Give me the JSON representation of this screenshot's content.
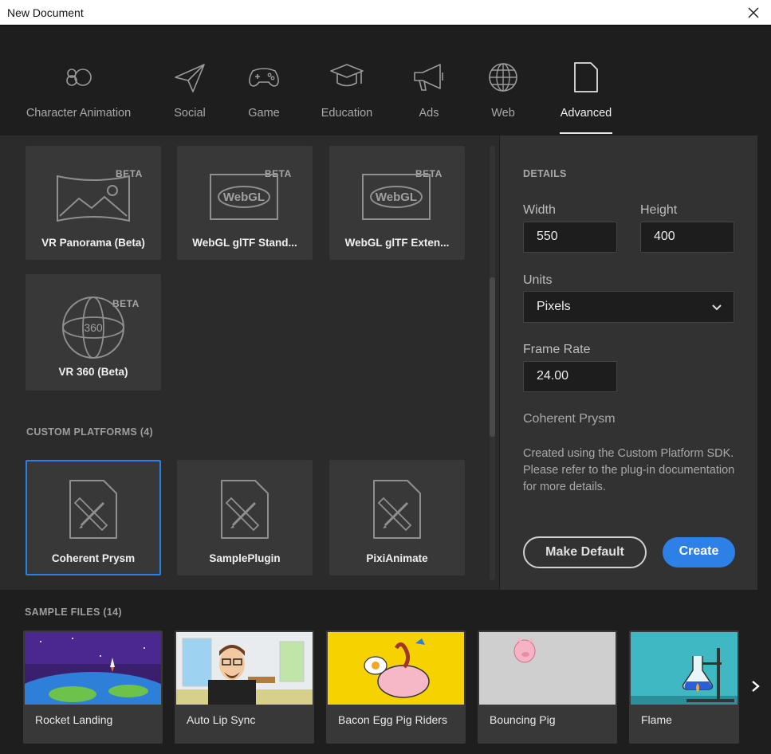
{
  "window": {
    "title": "New Document"
  },
  "tabs": [
    {
      "label": "Character Animation",
      "icon": "character-animation-icon"
    },
    {
      "label": "Social",
      "icon": "paper-plane-icon"
    },
    {
      "label": "Game",
      "icon": "gamepad-icon"
    },
    {
      "label": "Education",
      "icon": "graduation-cap-icon"
    },
    {
      "label": "Ads",
      "icon": "megaphone-icon"
    },
    {
      "label": "Web",
      "icon": "globe-icon"
    },
    {
      "label": "Advanced",
      "icon": "document-icon",
      "active": true
    }
  ],
  "presets": {
    "top_cards": [
      {
        "label": "VR Panorama (Beta)",
        "badge": "BETA",
        "icon": "vr-panorama-icon"
      },
      {
        "label": "WebGL glTF Stand...",
        "badge": "BETA",
        "icon": "webgl-icon"
      },
      {
        "label": "WebGL glTF Exten...",
        "badge": "BETA",
        "icon": "webgl-icon"
      },
      {
        "label": "VR 360 (Beta)",
        "badge": "BETA",
        "icon": "vr-360-icon"
      }
    ],
    "vr360_text": "360",
    "webgl_text": "WebGL",
    "custom_platforms_heading": "CUSTOM PLATFORMS (4)",
    "custom_platforms": [
      {
        "label": "Coherent Prysm",
        "selected": true,
        "icon": "plugin-document-icon"
      },
      {
        "label": "SamplePlugin",
        "icon": "plugin-document-icon"
      },
      {
        "label": "PixiAnimate",
        "icon": "plugin-document-icon"
      }
    ]
  },
  "details": {
    "heading": "DETAILS",
    "width_label": "Width",
    "width_value": "550",
    "height_label": "Height",
    "height_value": "400",
    "units_label": "Units",
    "units_value": "Pixels",
    "frame_rate_label": "Frame Rate",
    "frame_rate_value": "24.00",
    "preset_name": "Coherent Prysm",
    "preset_description": "Created using the Custom Platform SDK. Please refer to the plug-in documentation for more details.",
    "make_default_label": "Make Default",
    "create_label": "Create"
  },
  "samples": {
    "heading": "SAMPLE FILES (14)",
    "items": [
      {
        "label": "Rocket Landing"
      },
      {
        "label": "Auto Lip Sync"
      },
      {
        "label": "Bacon Egg Pig Riders"
      },
      {
        "label": "Bouncing Pig"
      },
      {
        "label": "Flame"
      }
    ]
  },
  "colors": {
    "accent": "#2d80e6",
    "panel": "#2b2b2b",
    "card": "#383838"
  }
}
